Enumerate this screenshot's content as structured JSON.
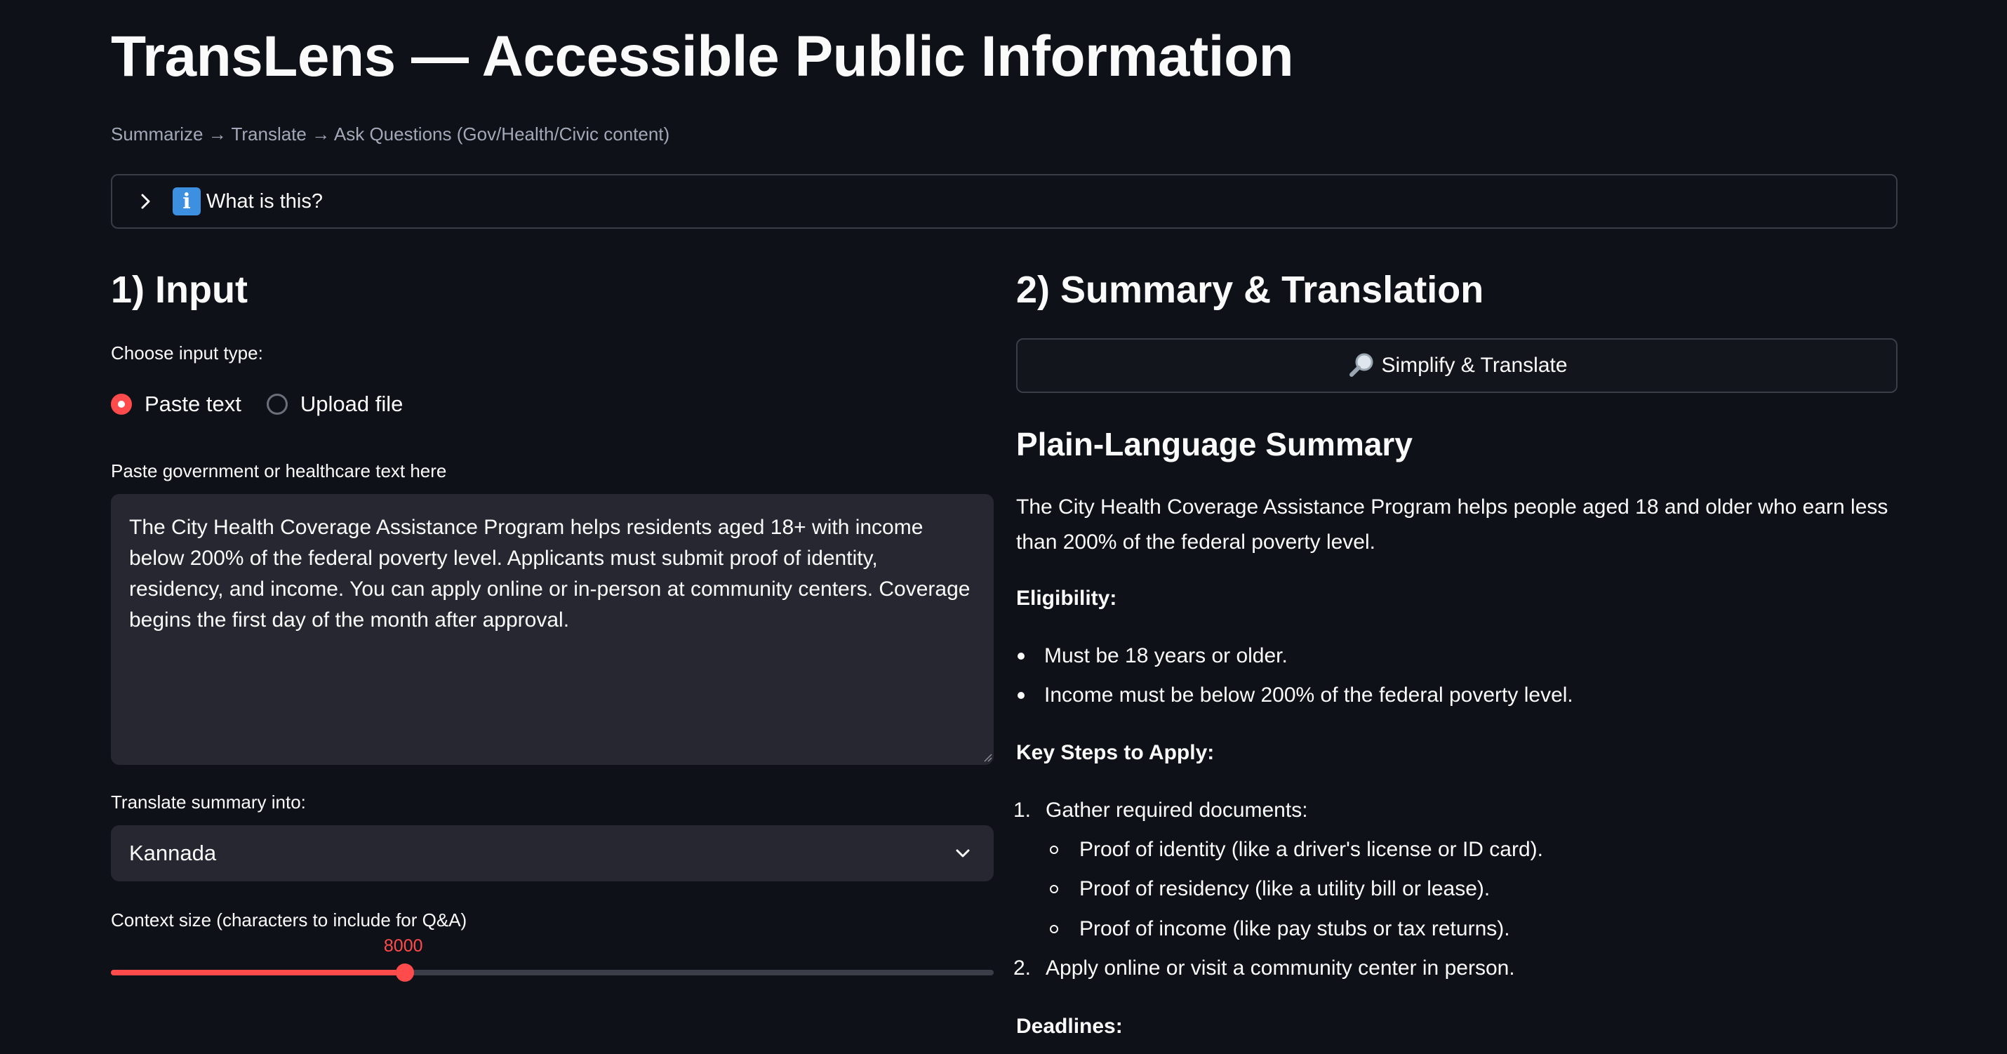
{
  "app": {
    "title": "TransLens — Accessible Public Information",
    "caption": "Summarize → Translate → Ask Questions (Gov/Health/Civic content)"
  },
  "expander": {
    "icon": "info-icon",
    "label": "What is this?"
  },
  "input": {
    "heading": "1) Input",
    "choose_label": "Choose input type:",
    "radio_options": [
      "Paste text",
      "Upload file"
    ],
    "radio_selected": "Paste text",
    "textarea_label": "Paste government or healthcare text here",
    "textarea_value": "The City Health Coverage Assistance Program helps residents aged 18+ with income below 200% of the federal poverty level. Applicants must submit proof of identity, residency, and income. You can apply online or in-person at community centers. Coverage begins the first day of the month after approval.",
    "translate_label": "Translate summary into:",
    "language_selected": "Kannada",
    "slider_label": "Context size (characters to include for Q&A)",
    "slider_value": "8000",
    "slider_fraction": 0.333
  },
  "summary": {
    "heading": "2) Summary & Translation",
    "button_label": "Simplify & Translate",
    "button_icon": "magnifier-icon",
    "section_title": "Plain-Language Summary",
    "intro": "The City Health Coverage Assistance Program helps people aged 18 and older who earn less than 200% of the federal poverty level.",
    "eligibility_title": "Eligibility:",
    "eligibility_items": [
      "Must be 18 years or older.",
      "Income must be below 200% of the federal poverty level."
    ],
    "steps_title": "Key Steps to Apply:",
    "step1": "Gather required documents:",
    "step1_sub": [
      "Proof of identity (like a driver's license or ID card).",
      "Proof of residency (like a utility bill or lease).",
      "Proof of income (like pay stubs or tax returns)."
    ],
    "step2": "Apply online or visit a community center in person.",
    "deadlines_title": "Deadlines:"
  },
  "colors": {
    "background": "#0e1117",
    "accent": "#ff4b4b",
    "input_bg": "#262730"
  }
}
